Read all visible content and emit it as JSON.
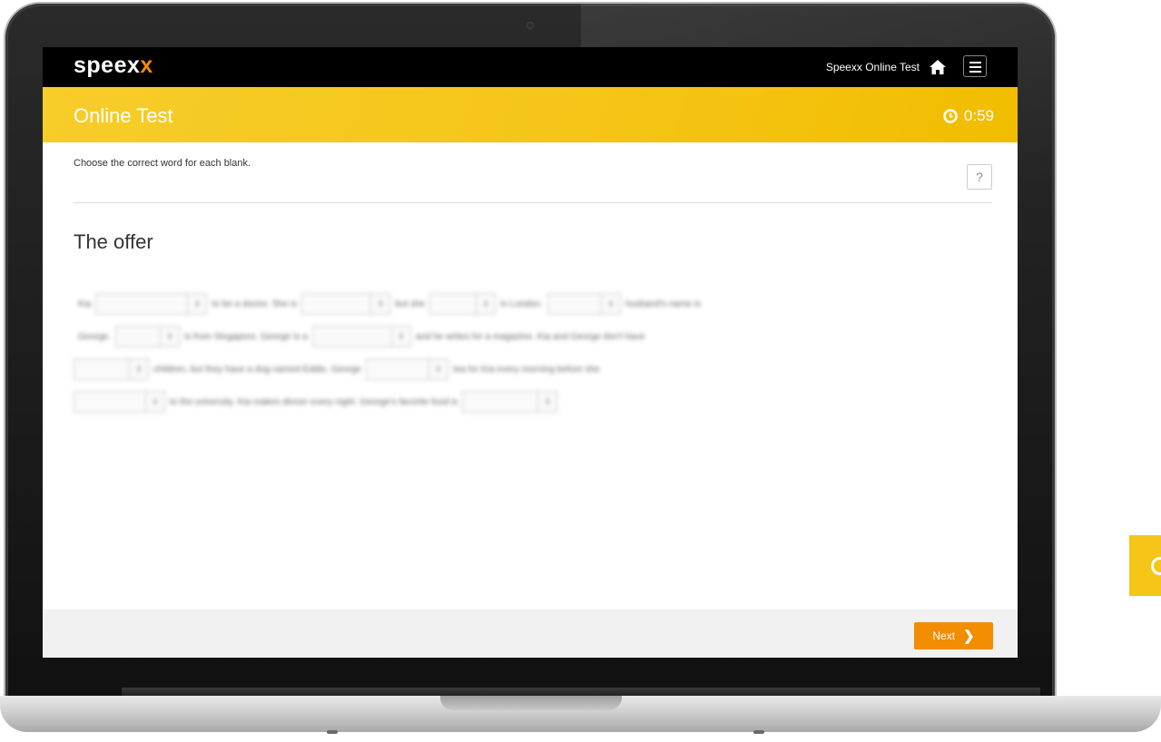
{
  "header": {
    "logo_main": "speex",
    "logo_accent": "x",
    "site_name": "Speexx Online Test"
  },
  "banner": {
    "title": "Online Test",
    "timer": "0:59"
  },
  "content": {
    "instruction": "Choose the correct word for each blank.",
    "help_label": "?",
    "test_title": "The offer"
  },
  "exercise": {
    "line1": {
      "w1": "Kia",
      "w2": "to be a doctor. She is",
      "w3": "but she",
      "w4": "in London.",
      "w5": "husband's name is"
    },
    "line2": {
      "w1": "George.",
      "w2": "is from Singapore. George is a",
      "w3": "and he writes for a magazine. Kia and George don't have"
    },
    "line3": {
      "w1": "children, but they have a dog named Eddie. George",
      "w2": "tea for Kia every morning before she"
    },
    "line4": {
      "w1": "to the university. Kia makes dinner every night. George's favorite food is"
    }
  },
  "footer": {
    "next_label": "Next",
    "next_icon": "chevron-right-icon"
  },
  "colors": {
    "accent_yellow": "#f5c518",
    "accent_orange": "#f28c00",
    "topbar": "#000000"
  }
}
